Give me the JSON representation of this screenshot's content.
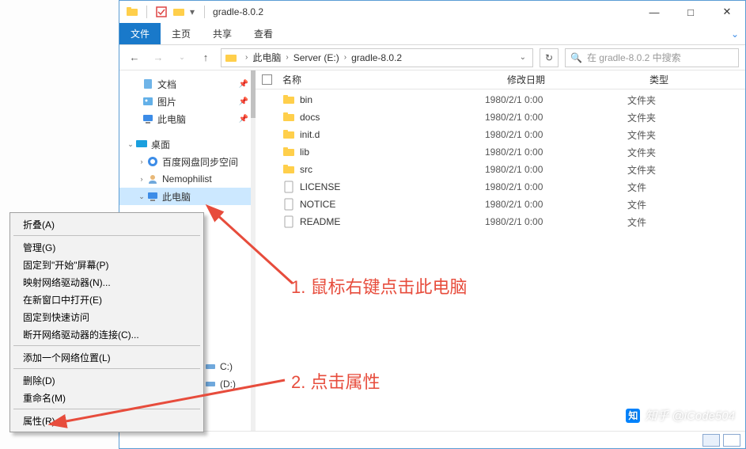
{
  "window_title": "gradle-8.0.2",
  "ribbon": {
    "file": "文件",
    "home": "主页",
    "share": "共享",
    "view": "查看"
  },
  "breadcrumbs": [
    "此电脑",
    "Server (E:)",
    "gradle-8.0.2"
  ],
  "search_placeholder": "在 gradle-8.0.2 中搜索",
  "columns": {
    "name": "名称",
    "date": "修改日期",
    "type": "类型"
  },
  "sidebar_top": [
    {
      "label": "文档",
      "icon": "doc"
    },
    {
      "label": "图片",
      "icon": "pic"
    },
    {
      "label": "此电脑",
      "icon": "pc"
    }
  ],
  "sidebar_desktop_label": "桌面",
  "sidebar_desktop_children": [
    {
      "label": "百度网盘同步空间",
      "icon": "baidu"
    },
    {
      "label": "Nemophilist",
      "icon": "user"
    },
    {
      "label": "此电脑",
      "icon": "pc",
      "selected": true
    }
  ],
  "hidden_drives": [
    "C:)",
    "(D:)"
  ],
  "files": [
    {
      "name": "bin",
      "date": "1980/2/1 0:00",
      "type": "文件夹",
      "kind": "folder"
    },
    {
      "name": "docs",
      "date": "1980/2/1 0:00",
      "type": "文件夹",
      "kind": "folder"
    },
    {
      "name": "init.d",
      "date": "1980/2/1 0:00",
      "type": "文件夹",
      "kind": "folder"
    },
    {
      "name": "lib",
      "date": "1980/2/1 0:00",
      "type": "文件夹",
      "kind": "folder"
    },
    {
      "name": "src",
      "date": "1980/2/1 0:00",
      "type": "文件夹",
      "kind": "folder"
    },
    {
      "name": "LICENSE",
      "date": "1980/2/1 0:00",
      "type": "文件",
      "kind": "file"
    },
    {
      "name": "NOTICE",
      "date": "1980/2/1 0:00",
      "type": "文件",
      "kind": "file"
    },
    {
      "name": "README",
      "date": "1980/2/1 0:00",
      "type": "文件",
      "kind": "file"
    }
  ],
  "context_menu": [
    {
      "label": "折叠(A)"
    },
    {
      "sep": true
    },
    {
      "label": "管理(G)"
    },
    {
      "label": "固定到\"开始\"屏幕(P)"
    },
    {
      "label": "映射网络驱动器(N)..."
    },
    {
      "label": "在新窗口中打开(E)"
    },
    {
      "label": "固定到快速访问"
    },
    {
      "label": "断开网络驱动器的连接(C)..."
    },
    {
      "sep": true
    },
    {
      "label": "添加一个网络位置(L)"
    },
    {
      "sep": true
    },
    {
      "label": "删除(D)"
    },
    {
      "label": "重命名(M)"
    },
    {
      "sep": true
    },
    {
      "label": "属性(R)"
    }
  ],
  "annotations": {
    "one": "1. 鼠标右键点击此电脑",
    "two": "2. 点击属性"
  },
  "watermark": "知乎 @iCode504"
}
